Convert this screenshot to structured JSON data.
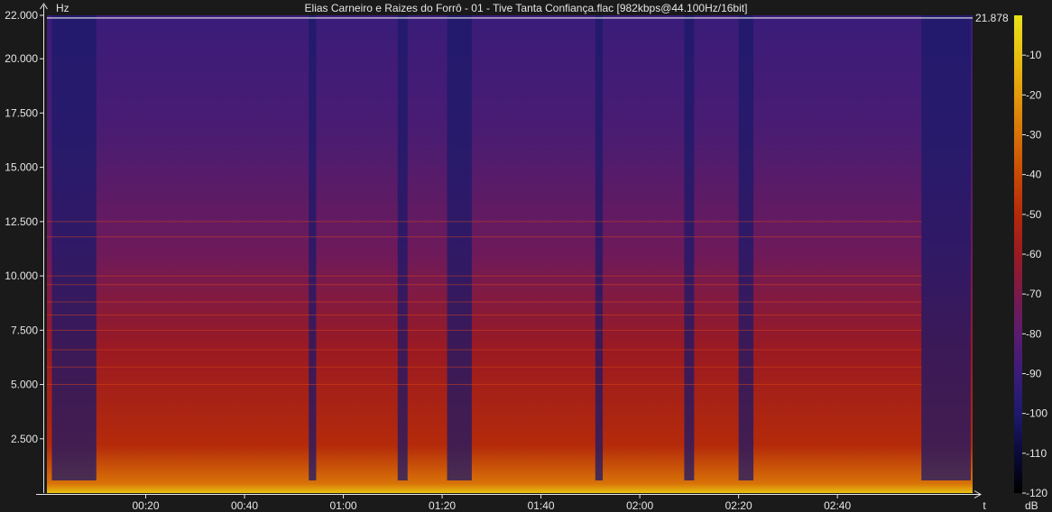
{
  "chart_data": {
    "type": "heatmap",
    "title": "Elias Carneiro e Raizes do Forrô - 01 - Tive Tanta Confiança.flac [982kbps@44.100Hz/16bit]",
    "ylabel": "Hz",
    "xlabel": "t",
    "ylim": [
      0,
      22000
    ],
    "y_ticks": [
      {
        "value": 22000,
        "label": "22.000"
      },
      {
        "value": 20000,
        "label": "20.000"
      },
      {
        "value": 17500,
        "label": "17.500"
      },
      {
        "value": 15000,
        "label": "15.000"
      },
      {
        "value": 12500,
        "label": "12.500"
      },
      {
        "value": 10000,
        "label": "10.000"
      },
      {
        "value": 7500,
        "label": "7.500"
      },
      {
        "value": 5000,
        "label": "5.000"
      },
      {
        "value": 2500,
        "label": "2.500"
      }
    ],
    "xlim_seconds": [
      0,
      187
    ],
    "x_ticks": [
      {
        "value": 20,
        "label": "00:20"
      },
      {
        "value": 40,
        "label": "00:40"
      },
      {
        "value": 60,
        "label": "01:00"
      },
      {
        "value": 80,
        "label": "01:20"
      },
      {
        "value": 100,
        "label": "01:40"
      },
      {
        "value": 120,
        "label": "02:00"
      },
      {
        "value": 140,
        "label": "02:20"
      },
      {
        "value": 160,
        "label": "02:40"
      }
    ],
    "cutoff": {
      "value": 21878,
      "label": "21.878"
    },
    "colorbar": {
      "label": "dB",
      "range": [
        -120,
        0
      ],
      "ticks": [
        {
          "value": -10,
          "label": "-10"
        },
        {
          "value": -20,
          "label": "-20"
        },
        {
          "value": -30,
          "label": "-30"
        },
        {
          "value": -40,
          "label": "-40"
        },
        {
          "value": -50,
          "label": "-50"
        },
        {
          "value": -60,
          "label": "-60"
        },
        {
          "value": -70,
          "label": "-70"
        },
        {
          "value": -80,
          "label": "-80"
        },
        {
          "value": -90,
          "label": "-90"
        },
        {
          "value": -100,
          "label": "-100"
        },
        {
          "value": -110,
          "label": "-110"
        },
        {
          "value": -120,
          "label": "-120"
        }
      ],
      "colors": [
        "#000000",
        "#0a0a3a",
        "#1e1a6e",
        "#3a1c7a",
        "#5a1c6e",
        "#7a1a4a",
        "#9a1a22",
        "#b42a0a",
        "#c84a06",
        "#d87208",
        "#e29a0c",
        "#e8c010",
        "#e8e21a"
      ]
    },
    "quiet_intervals_seconds": [
      {
        "start": 1,
        "end": 10
      },
      {
        "start": 53,
        "end": 54.5
      },
      {
        "start": 71,
        "end": 73
      },
      {
        "start": 81,
        "end": 86
      },
      {
        "start": 111,
        "end": 112.5
      },
      {
        "start": 129,
        "end": 131
      },
      {
        "start": 140,
        "end": 143
      },
      {
        "start": 177,
        "end": 187
      }
    ]
  }
}
